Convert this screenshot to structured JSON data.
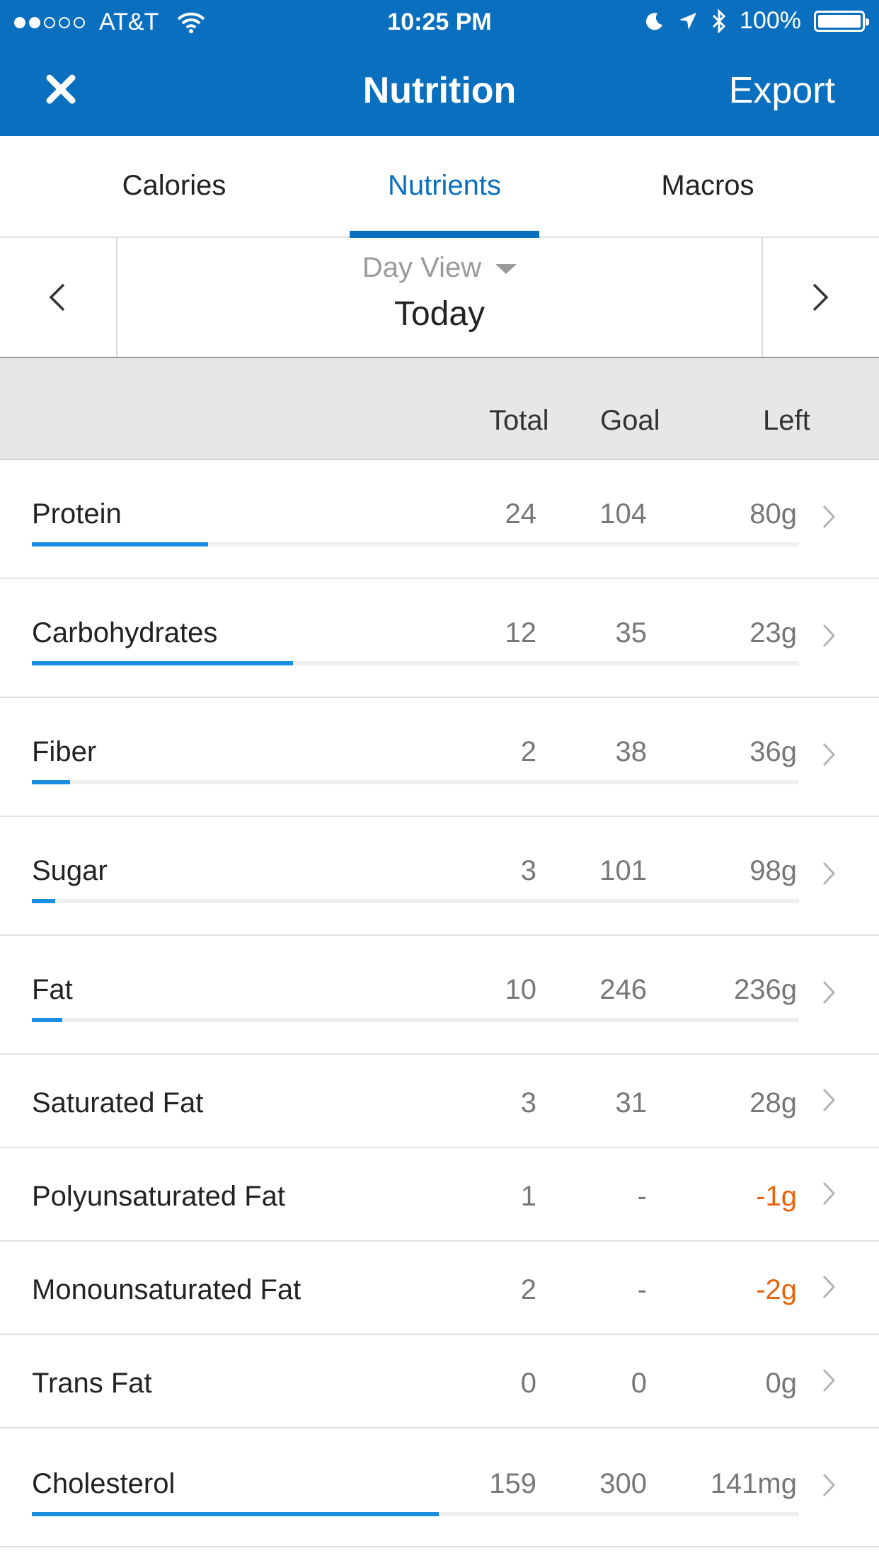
{
  "status_bar": {
    "carrier": "AT&T",
    "signal_bars_filled": 2,
    "signal_bars_total": 5,
    "time": "10:25 PM",
    "battery": "100%",
    "icons": [
      "wifi-icon",
      "moon-icon",
      "location-arrow-icon",
      "bluetooth-icon",
      "battery-icon"
    ]
  },
  "nav": {
    "title": "Nutrition",
    "close_icon": "close-icon",
    "export_label": "Export"
  },
  "tabs": {
    "items": [
      {
        "label": "Calories"
      },
      {
        "label": "Nutrients"
      },
      {
        "label": "Macros"
      }
    ],
    "active": "Nutrients"
  },
  "day_selector": {
    "mode": "Day View",
    "label": "Today"
  },
  "columns": {
    "total": "Total",
    "goal": "Goal",
    "left": "Left"
  },
  "rows": [
    {
      "name": "Protein",
      "total": "24",
      "goal": "104",
      "left": "80g",
      "progress": 0.23
    },
    {
      "name": "Carbohydrates",
      "total": "12",
      "goal": "35",
      "left": "23g",
      "progress": 0.34
    },
    {
      "name": "Fiber",
      "total": "2",
      "goal": "38",
      "left": "36g",
      "progress": 0.05
    },
    {
      "name": "Sugar",
      "total": "3",
      "goal": "101",
      "left": "98g",
      "progress": 0.03
    },
    {
      "name": "Fat",
      "total": "10",
      "goal": "246",
      "left": "236g",
      "progress": 0.04
    },
    {
      "name": "Saturated Fat",
      "total": "3",
      "goal": "31",
      "left": "28g"
    },
    {
      "name": "Polyunsaturated Fat",
      "total": "1",
      "goal": "-",
      "left": "-1g",
      "negative": true
    },
    {
      "name": "Monounsaturated Fat",
      "total": "2",
      "goal": "-",
      "left": "-2g",
      "negative": true
    },
    {
      "name": "Trans Fat",
      "total": "0",
      "goal": "0",
      "left": "0g"
    },
    {
      "name": "Cholesterol",
      "total": "159",
      "goal": "300",
      "left": "141mg",
      "progress": 0.53
    }
  ],
  "colors": {
    "header_bg": "#0a6fbf",
    "accent": "#0a6fbf",
    "progress": "#1a8fe2",
    "negative": "#e8640c"
  }
}
